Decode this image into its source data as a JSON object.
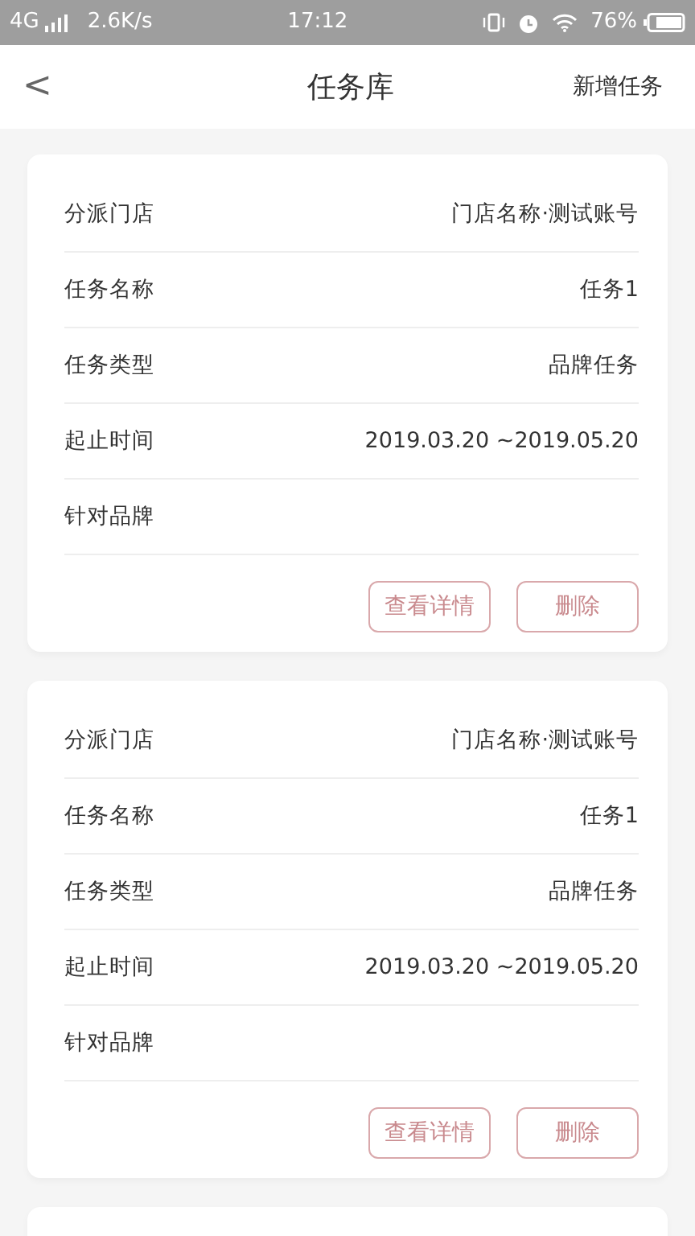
{
  "status_bar": {
    "network": "4G",
    "speed": "2.6K/s",
    "time": "17:12",
    "battery": "76%"
  },
  "header": {
    "back": "<",
    "title": "任务库",
    "action": "新增任务"
  },
  "cards": [
    {
      "kind": "task",
      "rows": [
        {
          "label": "分派门店",
          "value": "门店名称·测试账号"
        },
        {
          "label": "任务名称",
          "value": "任务1"
        },
        {
          "label": "任务类型",
          "value": "品牌任务"
        },
        {
          "label": "起止时间",
          "value": "2019.03.20 ~2019.05.20"
        },
        {
          "label": "针对品牌"
        }
      ],
      "buttons": [
        "查看详情",
        "删除"
      ]
    },
    {
      "kind": "task",
      "rows": [
        {
          "label": "分派门店",
          "value": "门店名称·测试账号"
        },
        {
          "label": "任务名称",
          "value": "任务1"
        },
        {
          "label": "任务类型",
          "value": "品牌任务"
        },
        {
          "label": "起止时间",
          "value": "2019.03.20 ~2019.05.20"
        },
        {
          "label": "针对品牌"
        }
      ],
      "buttons": [
        "查看详情",
        "删除"
      ]
    },
    {
      "kind": "cut"
    }
  ]
}
